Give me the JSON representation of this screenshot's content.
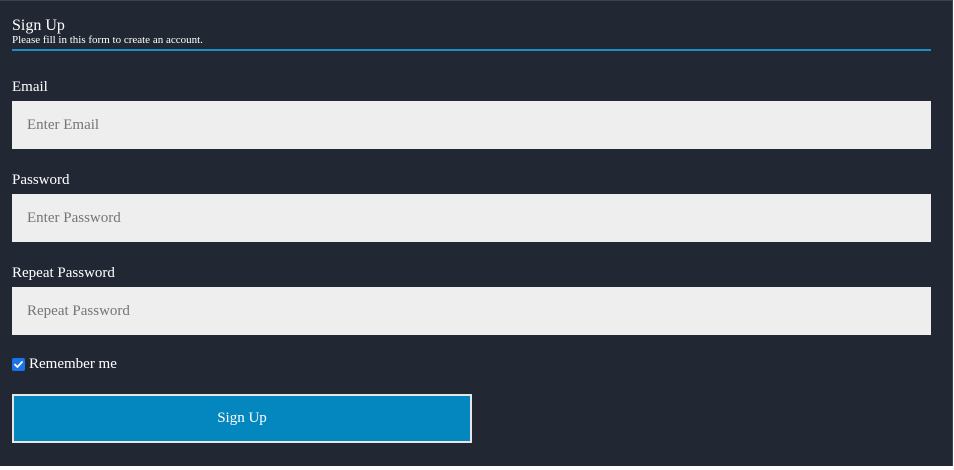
{
  "form": {
    "title": "Sign Up",
    "subtitle": "Please fill in this form to create an account.",
    "email": {
      "label": "Email",
      "placeholder": "Enter Email",
      "value": ""
    },
    "password": {
      "label": "Password",
      "placeholder": "Enter Password",
      "value": ""
    },
    "repeat_password": {
      "label": "Repeat Password",
      "placeholder": "Repeat Password",
      "value": ""
    },
    "remember": {
      "label": "Remember me",
      "checked": true
    },
    "submit_label": "Sign Up"
  },
  "colors": {
    "background": "#212733",
    "accent": "#0486be",
    "divider": "#1a8fc4",
    "input_background": "#eeeeee",
    "checkbox": "#1a73e8"
  }
}
